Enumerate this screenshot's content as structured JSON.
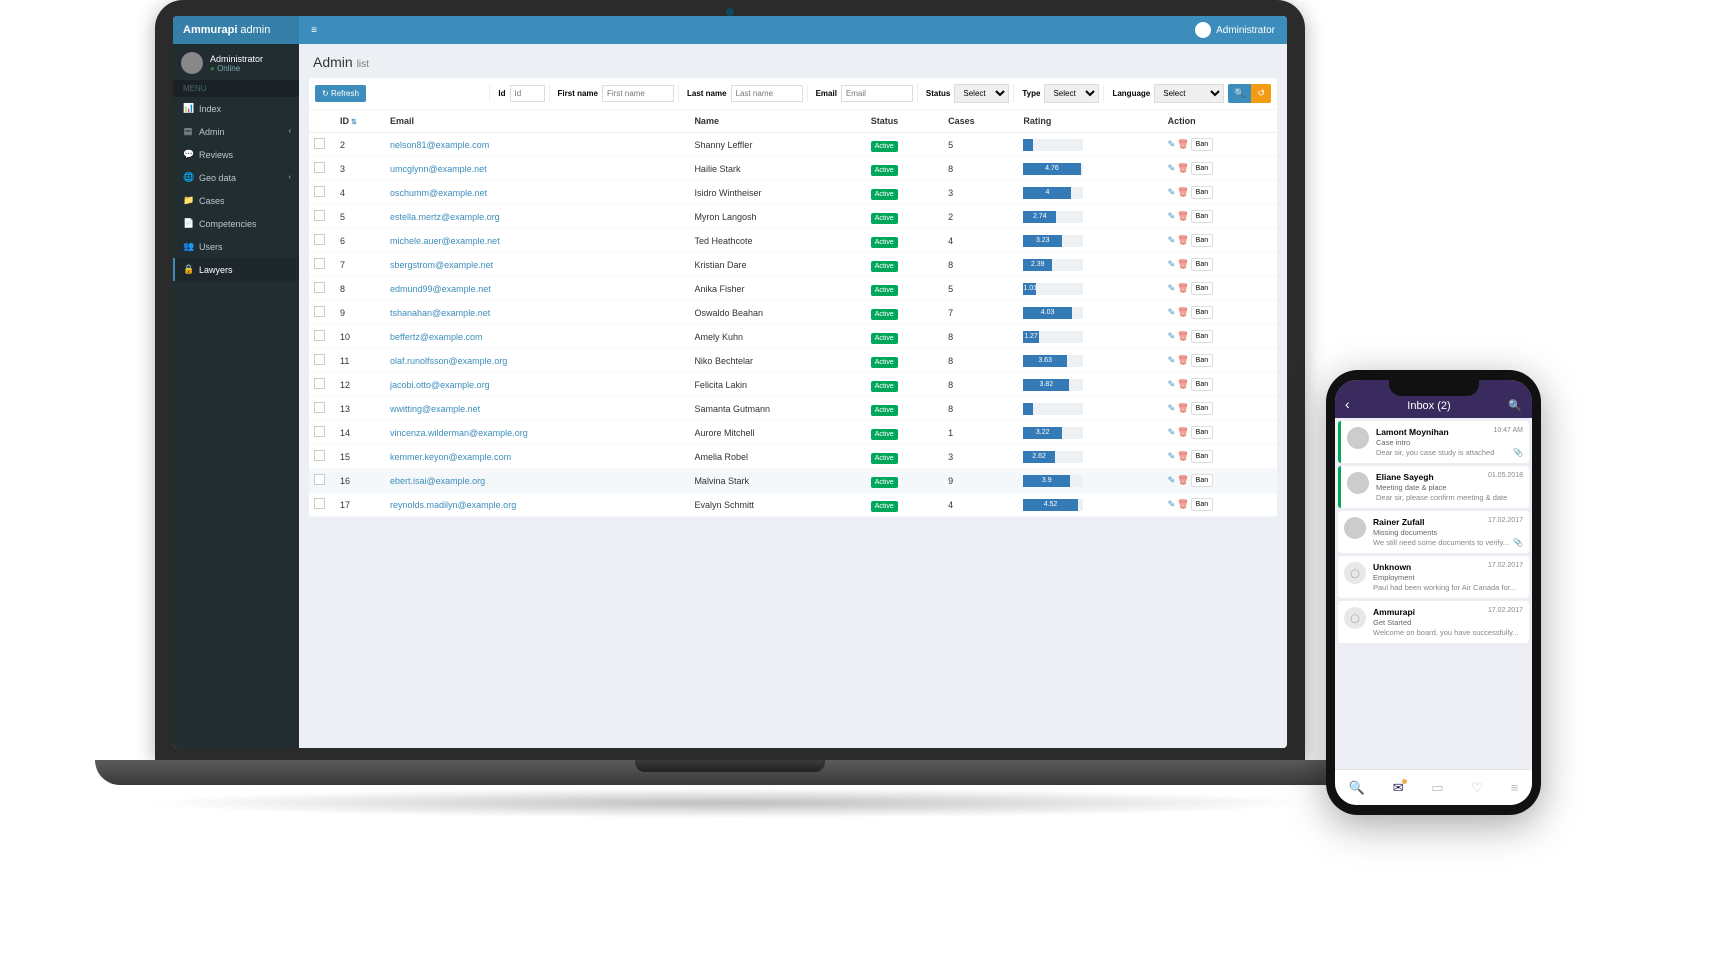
{
  "brand": {
    "name": "Ammurapi",
    "suffix": "admin"
  },
  "topbar": {
    "userName": "Administrator"
  },
  "sidebar": {
    "userName": "Administrator",
    "userStatus": "Online",
    "menuHeader": "Menu",
    "items": [
      {
        "label": "Index",
        "icon": "chart",
        "sub": false
      },
      {
        "label": "Admin",
        "icon": "list",
        "sub": true
      },
      {
        "label": "Reviews",
        "icon": "chat",
        "sub": false
      },
      {
        "label": "Geo data",
        "icon": "globe",
        "sub": true
      },
      {
        "label": "Cases",
        "icon": "folder",
        "sub": false
      },
      {
        "label": "Competencies",
        "icon": "doc",
        "sub": false
      },
      {
        "label": "Users",
        "icon": "users",
        "sub": false
      },
      {
        "label": "Lawyers",
        "icon": "lock",
        "sub": false,
        "active": true
      }
    ]
  },
  "page": {
    "title": "Admin",
    "subtitle": "list"
  },
  "filters": {
    "refresh": "Refresh",
    "id": {
      "label": "Id",
      "placeholder": "Id"
    },
    "firstName": {
      "label": "First name",
      "placeholder": "First name"
    },
    "lastName": {
      "label": "Last name",
      "placeholder": "Last name"
    },
    "email": {
      "label": "Email",
      "placeholder": "Email"
    },
    "status": {
      "label": "Status",
      "placeholder": "Select"
    },
    "type": {
      "label": "Type",
      "placeholder": "Select"
    },
    "language": {
      "label": "Language",
      "placeholder": "Select"
    }
  },
  "table": {
    "headers": {
      "id": "ID",
      "email": "Email",
      "name": "Name",
      "status": "Status",
      "cases": "Cases",
      "rating": "Rating",
      "action": "Action"
    },
    "banLabel": "Ban",
    "statusActive": "Active",
    "rows": [
      {
        "id": 2,
        "email": "nelson81@example.com",
        "name": "Shanny Leffler",
        "cases": 5,
        "rating": 0.5
      },
      {
        "id": 3,
        "email": "umcglynn@example.net",
        "name": "Hailie Stark",
        "cases": 8,
        "rating": 4.76
      },
      {
        "id": 4,
        "email": "oschumm@example.net",
        "name": "Isidro Wintheiser",
        "cases": 3,
        "rating": 4
      },
      {
        "id": 5,
        "email": "estella.mertz@example.org",
        "name": "Myron Langosh",
        "cases": 2,
        "rating": 2.74
      },
      {
        "id": 6,
        "email": "michele.auer@example.net",
        "name": "Ted Heathcote",
        "cases": 4,
        "rating": 3.23
      },
      {
        "id": 7,
        "email": "sbergstrom@example.net",
        "name": "Kristian Dare",
        "cases": 8,
        "rating": 2.39
      },
      {
        "id": 8,
        "email": "edmund99@example.net",
        "name": "Anika Fisher",
        "cases": 5,
        "rating": 1.01
      },
      {
        "id": 9,
        "email": "tshanahan@example.net",
        "name": "Oswaldo Beahan",
        "cases": 7,
        "rating": 4.03
      },
      {
        "id": 10,
        "email": "beffertz@example.com",
        "name": "Amely Kuhn",
        "cases": 8,
        "rating": 1.27
      },
      {
        "id": 11,
        "email": "olaf.runolfsson@example.org",
        "name": "Niko Bechtelar",
        "cases": 8,
        "rating": 3.63
      },
      {
        "id": 12,
        "email": "jacobi.otto@example.org",
        "name": "Felicita Lakin",
        "cases": 8,
        "rating": 3.82
      },
      {
        "id": 13,
        "email": "wwitting@example.net",
        "name": "Samanta Gutmann",
        "cases": 8,
        "rating": 0.4
      },
      {
        "id": 14,
        "email": "vincenza.wilderman@example.org",
        "name": "Aurore Mitchell",
        "cases": 1,
        "rating": 3.22
      },
      {
        "id": 15,
        "email": "kemmer.keyon@example.com",
        "name": "Amelia Robel",
        "cases": 3,
        "rating": 2.62
      },
      {
        "id": 16,
        "email": "ebert.isai@example.org",
        "name": "Malvina Stark",
        "cases": 9,
        "rating": 3.9,
        "hover": true
      },
      {
        "id": 17,
        "email": "reynolds.madilyn@example.org",
        "name": "Evalyn Schmitt",
        "cases": 4,
        "rating": 4.52
      }
    ]
  },
  "phone": {
    "title": "Inbox (2)",
    "messages": [
      {
        "name": "Lamont Moynihan",
        "subject": "Case intro",
        "preview": "Dear sir, you case study is attached",
        "time": "10:47 AM",
        "accent": true,
        "attach": true
      },
      {
        "name": "Eliane Sayegh",
        "subject": "Meeting date & place",
        "preview": "Dear sir, please confirm meeting & date",
        "time": "01.05.2018",
        "accent": true
      },
      {
        "name": "Rainer Zufall",
        "subject": "Missing documents",
        "preview": "We still need some documents to verify...",
        "time": "17.02.2017",
        "attach": true
      },
      {
        "name": "Unknown",
        "subject": "Employment",
        "preview": "Paul had been working for Air Canada for...",
        "time": "17.02.2017",
        "stub": true
      },
      {
        "name": "Ammurapi",
        "subject": "Get Started",
        "preview": "Welcome on board, you have successfully...",
        "time": "17.02.2017",
        "stub": true
      }
    ]
  }
}
